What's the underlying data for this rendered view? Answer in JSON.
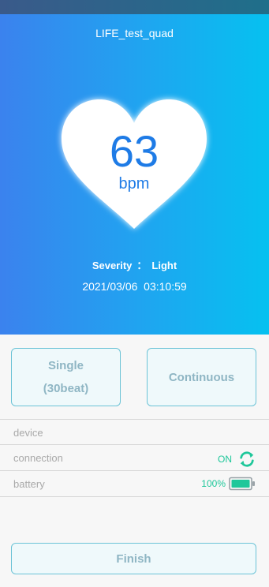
{
  "header": {
    "device_name": "LIFE_test_quad"
  },
  "measurement": {
    "value": "63",
    "unit": "bpm",
    "severity_label": "Severity",
    "severity_sep": "：",
    "severity_value": "Light",
    "timestamp": "2021/03/06  03:10:59"
  },
  "modes": {
    "single_line1": "Single",
    "single_line2": "(30beat)",
    "continuous": "Continuous"
  },
  "info": {
    "device_label": "device",
    "connection_label": "connection",
    "connection_value": "ON",
    "battery_label": "battery",
    "battery_value": "100%"
  },
  "actions": {
    "finish": "Finish"
  },
  "colors": {
    "accent": "#1ec79a",
    "hero_start": "#3b82ee",
    "hero_end": "#06c1f0",
    "bpm": "#1e7be6"
  },
  "icons": {
    "heart": "heart-icon",
    "connection": "sync-icon",
    "battery": "battery-full-icon"
  }
}
